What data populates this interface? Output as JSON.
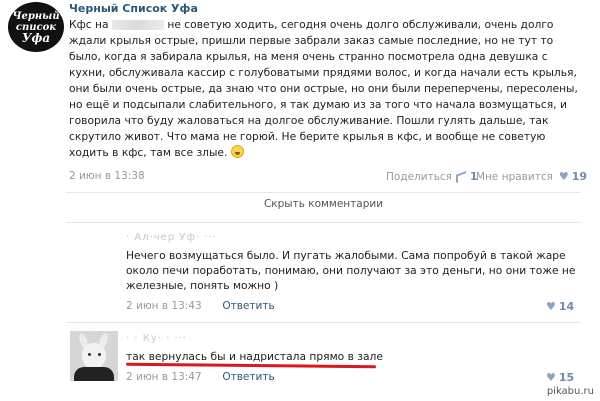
{
  "post": {
    "author": "Черный Список Уфа",
    "avatar_text": [
      "Черный",
      "список",
      "Уфа"
    ],
    "text_before_blur": "Кфс на",
    "text_after_blur": " не советую ходить, сегодня очень долго обслуживали, очень долго ждали крылья острые, пришли первые забрали заказ самые последние, но не тут то было, когда я забирала крылья, на меня очень странно посмотрела одна девушка с кухни, обслуживала кассир с голубоватыми прядями волос, и когда начали есть крылья, они были очень острые, да знаю что они острые, но они были переперчены, пересолены, но ещё и подсыпали слабительного, я так думаю из за того что начала возмущаться, и говорила что буду жаловаться на долгое обслуживание. Пошли гулять дальше, так скрутило живот. Что мама не горюй. Не берите крылья в кфс, и вообще не советую ходить в кфс, там все злые.",
    "date": "2 июн в 13:38",
    "share_label": "Поделиться",
    "share_count": "1",
    "like_label": "Мне нравится",
    "like_count": "19"
  },
  "toggle_comments": "Скрыть комментарии",
  "comments": [
    {
      "name": "· Ал·чер Уф· ···",
      "text": "Нечего возмущаться было. И пугать жалобыми. Сама попробуй в такой жаре около печи поработать, понимаю, они получают за это деньги, но они тоже не железные, понять можно )",
      "date": "2 июн в 13:43",
      "reply_label": "Ответить",
      "like_count": "14"
    },
    {
      "name": "·  ·   Ку· · ···",
      "text": "так вернулась бы и надристала прямо в зале",
      "date": "2 июн в 13:47",
      "reply_label": "Ответить",
      "like_count": "15"
    }
  ],
  "watermark": "pikabu.ru",
  "colors": {
    "link": "#2b587a",
    "muted": "#999999",
    "counter": "#6e8bab",
    "highlight": "#e0161d"
  }
}
